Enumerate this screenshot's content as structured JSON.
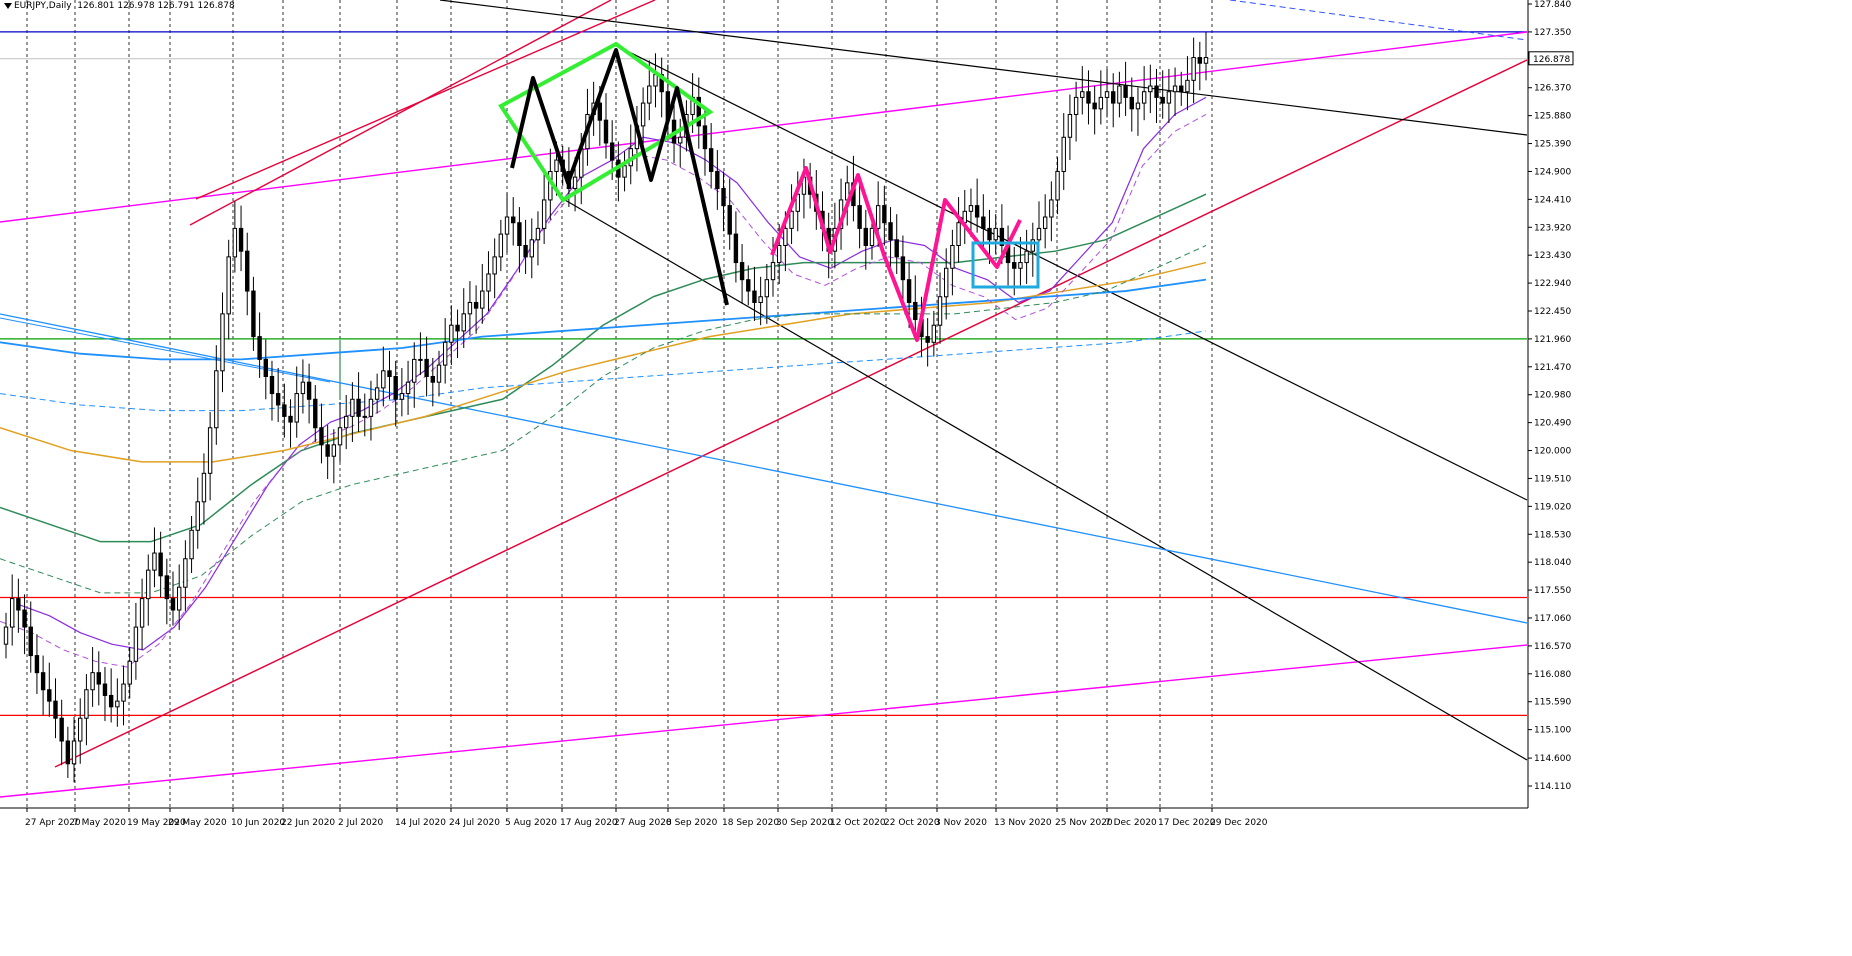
{
  "chart_data": {
    "type": "candlestick",
    "symbol": "EURJPY,Daily",
    "ohlc_header": "126.801 126.978 126.791 126.878",
    "current_price": "126.878",
    "ylim": [
      114.11,
      127.84
    ],
    "y_ticks": [
      "127.840",
      "127.350",
      "126.878",
      "126.370",
      "125.880",
      "125.390",
      "124.900",
      "124.410",
      "123.920",
      "123.430",
      "122.940",
      "122.450",
      "121.960",
      "121.470",
      "120.980",
      "120.490",
      "120.000",
      "119.510",
      "119.020",
      "118.530",
      "118.040",
      "117.550",
      "117.060",
      "116.570",
      "116.080",
      "115.590",
      "115.100",
      "114.600",
      "114.110"
    ],
    "x_ticks": [
      "27 Apr 2020",
      "7 May 2020",
      "19 May 2020",
      "29 May 2020",
      "10 Jun 2020",
      "22 Jun 2020",
      "2 Jul 2020",
      "14 Jul 2020",
      "24 Jul 2020",
      "5 Aug 2020",
      "17 Aug 2020",
      "27 Aug 2020",
      "8 Sep 2020",
      "18 Sep 2020",
      "30 Sep 2020",
      "12 Oct 2020",
      "22 Oct 2020",
      "3 Nov 2020",
      "13 Nov 2020",
      "25 Nov 2020",
      "7 Dec 2020",
      "17 Dec 2020",
      "29 Dec 2020"
    ],
    "closes": [
      116.9,
      117.4,
      117.2,
      116.9,
      116.4,
      116.1,
      115.8,
      115.6,
      115.3,
      114.9,
      114.5,
      114.9,
      115.3,
      115.8,
      116.1,
      115.9,
      115.7,
      115.5,
      115.6,
      115.9,
      116.3,
      116.9,
      117.4,
      117.9,
      118.2,
      117.8,
      117.4,
      117.2,
      117.6,
      118.1,
      118.6,
      119.1,
      119.6,
      120.4,
      121.4,
      122.4,
      123.4,
      123.9,
      123.5,
      122.8,
      122.0,
      121.6,
      121.3,
      121.0,
      120.8,
      120.6,
      120.5,
      121.0,
      121.2,
      120.9,
      120.4,
      120.1,
      119.9,
      120.1,
      120.4,
      120.6,
      120.9,
      120.6,
      120.6,
      120.9,
      121.1,
      121.4,
      121.3,
      120.9,
      121.0,
      121.2,
      121.6,
      121.6,
      121.3,
      121.2,
      121.5,
      121.9,
      122.2,
      122.1,
      122.4,
      122.6,
      122.5,
      122.8,
      123.1,
      123.4,
      123.8,
      124.1,
      124.0,
      123.6,
      123.4,
      123.7,
      123.9,
      124.4,
      124.9,
      125.1,
      124.9,
      124.6,
      124.8,
      125.3,
      125.9,
      126.1,
      125.8,
      125.4,
      125.1,
      124.8,
      125.0,
      125.3,
      125.7,
      126.1,
      126.4,
      126.6,
      126.3,
      125.8,
      125.4,
      125.5,
      125.9,
      126.2,
      125.7,
      125.3,
      124.9,
      124.6,
      124.3,
      123.8,
      123.3,
      123.0,
      122.8,
      122.6,
      122.7,
      123.0,
      123.3,
      123.6,
      123.9,
      124.2,
      124.5,
      124.8,
      124.5,
      124.2,
      123.9,
      123.5,
      123.9,
      124.4,
      124.7,
      124.3,
      123.9,
      123.6,
      123.9,
      124.3,
      124.0,
      123.7,
      123.4,
      123.0,
      122.6,
      122.3,
      122.0,
      121.9,
      122.2,
      122.7,
      123.2,
      123.6,
      124.0,
      124.2,
      124.3,
      124.1,
      123.9,
      123.7,
      123.9,
      123.6,
      123.3,
      123.2,
      123.3,
      123.5,
      123.7,
      123.9,
      124.1,
      124.4,
      124.9,
      125.5,
      125.9,
      126.2,
      126.3,
      126.1,
      126.0,
      126.2,
      126.3,
      126.1,
      126.4,
      126.2,
      126.0,
      126.1,
      126.3,
      126.4,
      126.2,
      126.1,
      126.3,
      126.4,
      126.3,
      126.5,
      126.9,
      126.8,
      126.9
    ],
    "indicators": {
      "ma_purple": [
        117.3,
        117.1,
        116.8,
        116.6,
        116.5,
        116.9,
        117.6,
        118.5,
        119.4,
        120.1,
        120.5,
        120.7,
        121.0,
        121.4,
        121.9,
        122.4,
        123.2,
        124.1,
        124.8,
        125.1,
        125.5,
        125.4,
        125.1,
        124.7,
        124.0,
        123.4,
        123.2,
        123.5,
        123.7,
        123.6,
        123.2,
        123.0,
        122.6,
        122.8,
        123.4,
        124.0,
        125.3,
        125.9,
        126.2
      ],
      "ma_green": [
        119.0,
        118.7,
        118.4,
        118.4,
        118.7,
        119.4,
        120.0,
        120.3,
        120.5,
        120.7,
        120.9,
        121.5,
        122.2,
        122.7,
        123.0,
        123.2,
        123.3,
        123.3,
        123.3,
        123.3,
        123.4,
        123.5,
        123.7,
        124.1,
        124.5
      ],
      "ma_orange": [
        120.4,
        120.0,
        119.8,
        119.8,
        120.0,
        120.3,
        120.6,
        121.0,
        121.4,
        121.7,
        122.0,
        122.2,
        122.4,
        122.5,
        122.6,
        122.8,
        123.0,
        123.3
      ],
      "ma_blue": [
        121.9,
        121.7,
        121.6,
        121.6,
        121.7,
        121.8,
        122.0,
        122.1,
        122.2,
        122.3,
        122.4,
        122.5,
        122.6,
        122.7,
        122.8,
        123.0
      ]
    },
    "horizontal_levels": [
      {
        "color": "#0000cc",
        "value": 127.35
      },
      {
        "color": "#00a000",
        "value": 121.96
      },
      {
        "color": "#ff0000",
        "value": 117.42
      },
      {
        "color": "#ff0000",
        "value": 115.35
      }
    ],
    "colors": {
      "bull": "#ffffff",
      "bear": "#000000",
      "wick": "#000000",
      "purple": "#8a2be2",
      "green": "#2e8b57",
      "orange": "#e0a020",
      "blue": "#1e90ff",
      "magenta": "#ff00ff",
      "red": "#e8003a",
      "lime": "#33ee33",
      "pink": "#ff1493",
      "cyan": "#1eaadf"
    }
  }
}
